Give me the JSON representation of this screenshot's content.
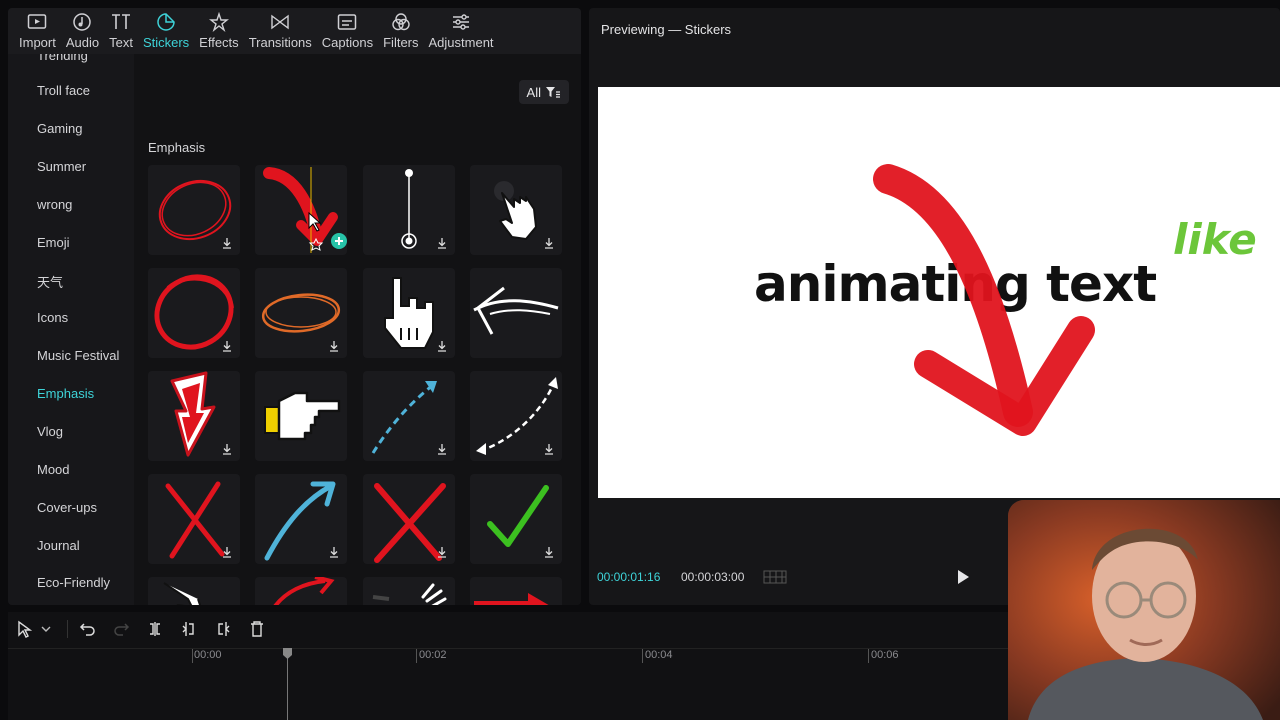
{
  "toolbar": {
    "tabs": [
      {
        "label": "Import",
        "icon": "import-icon"
      },
      {
        "label": "Audio",
        "icon": "audio-icon"
      },
      {
        "label": "Text",
        "icon": "text-icon"
      },
      {
        "label": "Stickers",
        "icon": "stickers-icon"
      },
      {
        "label": "Effects",
        "icon": "effects-icon"
      },
      {
        "label": "Transitions",
        "icon": "transitions-icon"
      },
      {
        "label": "Captions",
        "icon": "captions-icon"
      },
      {
        "label": "Filters",
        "icon": "filters-icon"
      },
      {
        "label": "Adjustment",
        "icon": "adjustment-icon"
      }
    ],
    "active": "Stickers"
  },
  "sidebar": {
    "items": [
      {
        "label": "Trending"
      },
      {
        "label": "Troll face"
      },
      {
        "label": "Gaming"
      },
      {
        "label": "Summer"
      },
      {
        "label": "wrong"
      },
      {
        "label": "Emoji"
      },
      {
        "label": "天气"
      },
      {
        "label": "Icons"
      },
      {
        "label": "Music Festival"
      },
      {
        "label": "Emphasis"
      },
      {
        "label": "Vlog"
      },
      {
        "label": "Mood"
      },
      {
        "label": "Cover-ups"
      },
      {
        "label": "Journal"
      },
      {
        "label": "Eco-Friendly"
      }
    ],
    "active": "Emphasis"
  },
  "content": {
    "filter_label": "All",
    "section_title": "Emphasis",
    "stickers": [
      "red-circle-scribble",
      "red-arrow-down",
      "pin-line",
      "white-hand-cursor",
      "red-circle-bold",
      "orange-oval",
      "pixel-hand-pointer",
      "white-arrow-left",
      "red-down-arrow-badge",
      "pixel-hand-right",
      "blue-dashed-arrow",
      "white-dashed-arrow",
      "red-x",
      "blue-arrow-up",
      "red-x-bold",
      "green-check",
      "hand-sticker",
      "red-curve-arrow",
      "gray-sticker",
      "here-banner"
    ]
  },
  "preview": {
    "title": "Previewing — Stickers",
    "canvas_text": "animating text",
    "canvas_accent_text": "like",
    "current_time": "00:00:01:16",
    "total_time": "00:00:03:00"
  },
  "timeline": {
    "ticks": [
      "00:00",
      "00:02",
      "00:04",
      "00:06"
    ]
  },
  "colors": {
    "accent": "#3ed3d8",
    "sticker_red": "#e0141e",
    "like_green": "#6cc63a"
  }
}
